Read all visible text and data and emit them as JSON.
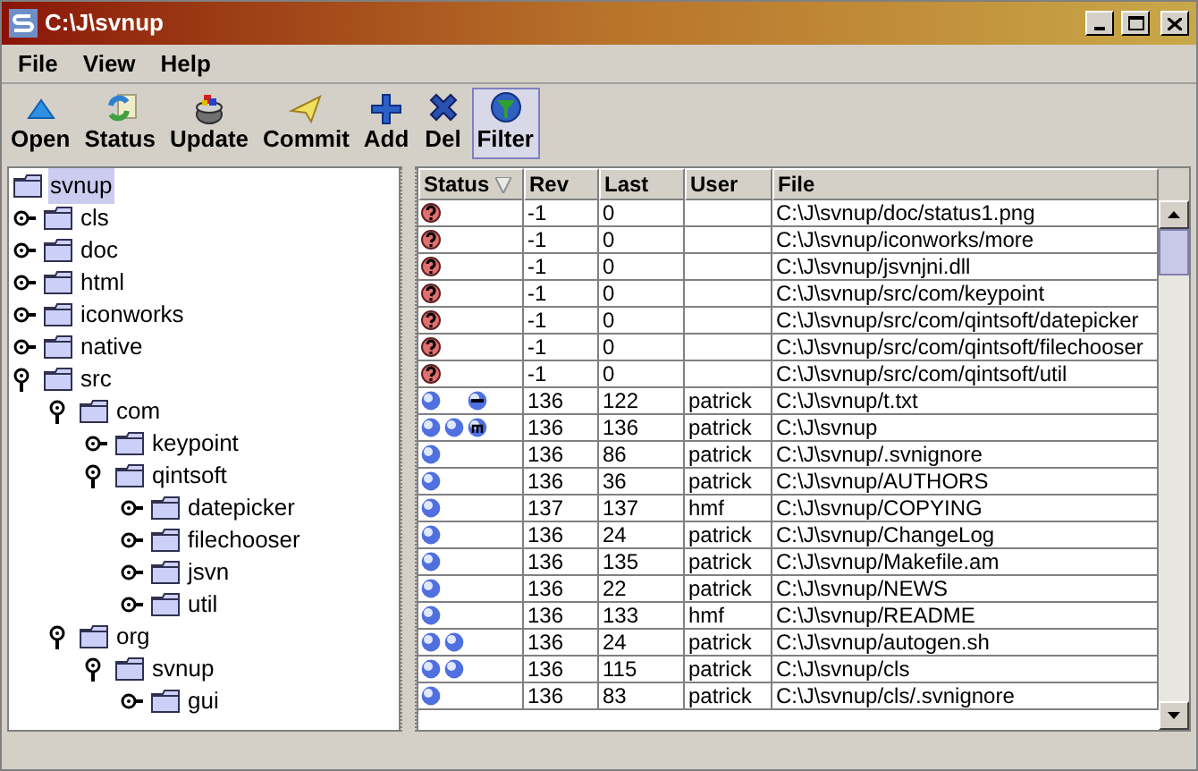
{
  "window": {
    "title": "C:\\J\\svnup"
  },
  "menu": [
    "File",
    "View",
    "Help"
  ],
  "toolbar": [
    {
      "label": "Open",
      "kind": "open",
      "selected": false
    },
    {
      "label": "Status",
      "kind": "status",
      "selected": false
    },
    {
      "label": "Update",
      "kind": "update",
      "selected": false
    },
    {
      "label": "Commit",
      "kind": "commit",
      "selected": false
    },
    {
      "label": "Add",
      "kind": "add",
      "selected": false
    },
    {
      "label": "Del",
      "kind": "del",
      "selected": false
    },
    {
      "label": "Filter",
      "kind": "filter",
      "selected": true
    }
  ],
  "tree": [
    {
      "label": "svnup",
      "selected": true,
      "children": [
        {
          "label": "cls",
          "selected": false,
          "expanded": false
        },
        {
          "label": "doc",
          "selected": false,
          "expanded": false
        },
        {
          "label": "html",
          "selected": false,
          "expanded": false
        },
        {
          "label": "iconworks",
          "selected": false,
          "expanded": false
        },
        {
          "label": "native",
          "selected": false,
          "expanded": false
        },
        {
          "label": "src",
          "selected": false,
          "expanded": true,
          "children": [
            {
              "label": "com",
              "selected": false,
              "expanded": true,
              "children": [
                {
                  "label": "keypoint",
                  "selected": false,
                  "expanded": false
                },
                {
                  "label": "qintsoft",
                  "selected": false,
                  "expanded": true,
                  "children": [
                    {
                      "label": "datepicker",
                      "selected": false,
                      "expanded": false
                    },
                    {
                      "label": "filechooser",
                      "selected": false,
                      "expanded": false
                    },
                    {
                      "label": "jsvn",
                      "selected": false,
                      "expanded": false
                    },
                    {
                      "label": "util",
                      "selected": false,
                      "expanded": false
                    }
                  ]
                }
              ]
            },
            {
              "label": "org",
              "selected": false,
              "expanded": true,
              "children": [
                {
                  "label": "svnup",
                  "selected": false,
                  "expanded": true,
                  "children": [
                    {
                      "label": "gui",
                      "selected": false,
                      "expanded": false
                    }
                  ]
                }
              ]
            }
          ]
        }
      ]
    }
  ],
  "table": {
    "columns": [
      "Status",
      "Rev",
      "Last",
      "User",
      "File"
    ],
    "rows": [
      {
        "status": [
          {
            "kind": "question"
          }
        ],
        "rev": "-1",
        "last": "0",
        "user": "",
        "file": "C:\\J\\svnup/doc/status1.png"
      },
      {
        "status": [
          {
            "kind": "question"
          }
        ],
        "rev": "-1",
        "last": "0",
        "user": "",
        "file": "C:\\J\\svnup/iconworks/more"
      },
      {
        "status": [
          {
            "kind": "question"
          }
        ],
        "rev": "-1",
        "last": "0",
        "user": "",
        "file": "C:\\J\\svnup/jsvnjni.dll"
      },
      {
        "status": [
          {
            "kind": "question"
          }
        ],
        "rev": "-1",
        "last": "0",
        "user": "",
        "file": "C:\\J\\svnup/src/com/keypoint"
      },
      {
        "status": [
          {
            "kind": "question"
          }
        ],
        "rev": "-1",
        "last": "0",
        "user": "",
        "file": "C:\\J\\svnup/src/com/qintsoft/datepicker"
      },
      {
        "status": [
          {
            "kind": "question"
          }
        ],
        "rev": "-1",
        "last": "0",
        "user": "",
        "file": "C:\\J\\svnup/src/com/qintsoft/filechooser"
      },
      {
        "status": [
          {
            "kind": "question"
          }
        ],
        "rev": "-1",
        "last": "0",
        "user": "",
        "file": "C:\\J\\svnup/src/com/qintsoft/util"
      },
      {
        "status": [
          {
            "kind": "ball"
          },
          {
            "kind": "gap"
          },
          {
            "kind": "minus"
          }
        ],
        "rev": "136",
        "last": "122",
        "user": "patrick",
        "file": "C:\\J\\svnup/t.txt"
      },
      {
        "status": [
          {
            "kind": "ball"
          },
          {
            "kind": "ball"
          },
          {
            "kind": "modified"
          }
        ],
        "rev": "136",
        "last": "136",
        "user": "patrick",
        "file": "C:\\J\\svnup"
      },
      {
        "status": [
          {
            "kind": "ball"
          }
        ],
        "rev": "136",
        "last": "86",
        "user": "patrick",
        "file": "C:\\J\\svnup/.svnignore"
      },
      {
        "status": [
          {
            "kind": "ball"
          }
        ],
        "rev": "136",
        "last": "36",
        "user": "patrick",
        "file": "C:\\J\\svnup/AUTHORS"
      },
      {
        "status": [
          {
            "kind": "ball"
          }
        ],
        "rev": "137",
        "last": "137",
        "user": "hmf",
        "file": "C:\\J\\svnup/COPYING"
      },
      {
        "status": [
          {
            "kind": "ball"
          }
        ],
        "rev": "136",
        "last": "24",
        "user": "patrick",
        "file": "C:\\J\\svnup/ChangeLog"
      },
      {
        "status": [
          {
            "kind": "ball"
          }
        ],
        "rev": "136",
        "last": "135",
        "user": "patrick",
        "file": "C:\\J\\svnup/Makefile.am"
      },
      {
        "status": [
          {
            "kind": "ball"
          }
        ],
        "rev": "136",
        "last": "22",
        "user": "patrick",
        "file": "C:\\J\\svnup/NEWS"
      },
      {
        "status": [
          {
            "kind": "ball"
          }
        ],
        "rev": "136",
        "last": "133",
        "user": "hmf",
        "file": "C:\\J\\svnup/README"
      },
      {
        "status": [
          {
            "kind": "ball"
          },
          {
            "kind": "ball"
          }
        ],
        "rev": "136",
        "last": "24",
        "user": "patrick",
        "file": "C:\\J\\svnup/autogen.sh"
      },
      {
        "status": [
          {
            "kind": "ball"
          },
          {
            "kind": "ball"
          }
        ],
        "rev": "136",
        "last": "115",
        "user": "patrick",
        "file": "C:\\J\\svnup/cls"
      },
      {
        "status": [
          {
            "kind": "ball"
          }
        ],
        "rev": "136",
        "last": "83",
        "user": "patrick",
        "file": "C:\\J\\svnup/cls/.svnignore"
      }
    ]
  }
}
